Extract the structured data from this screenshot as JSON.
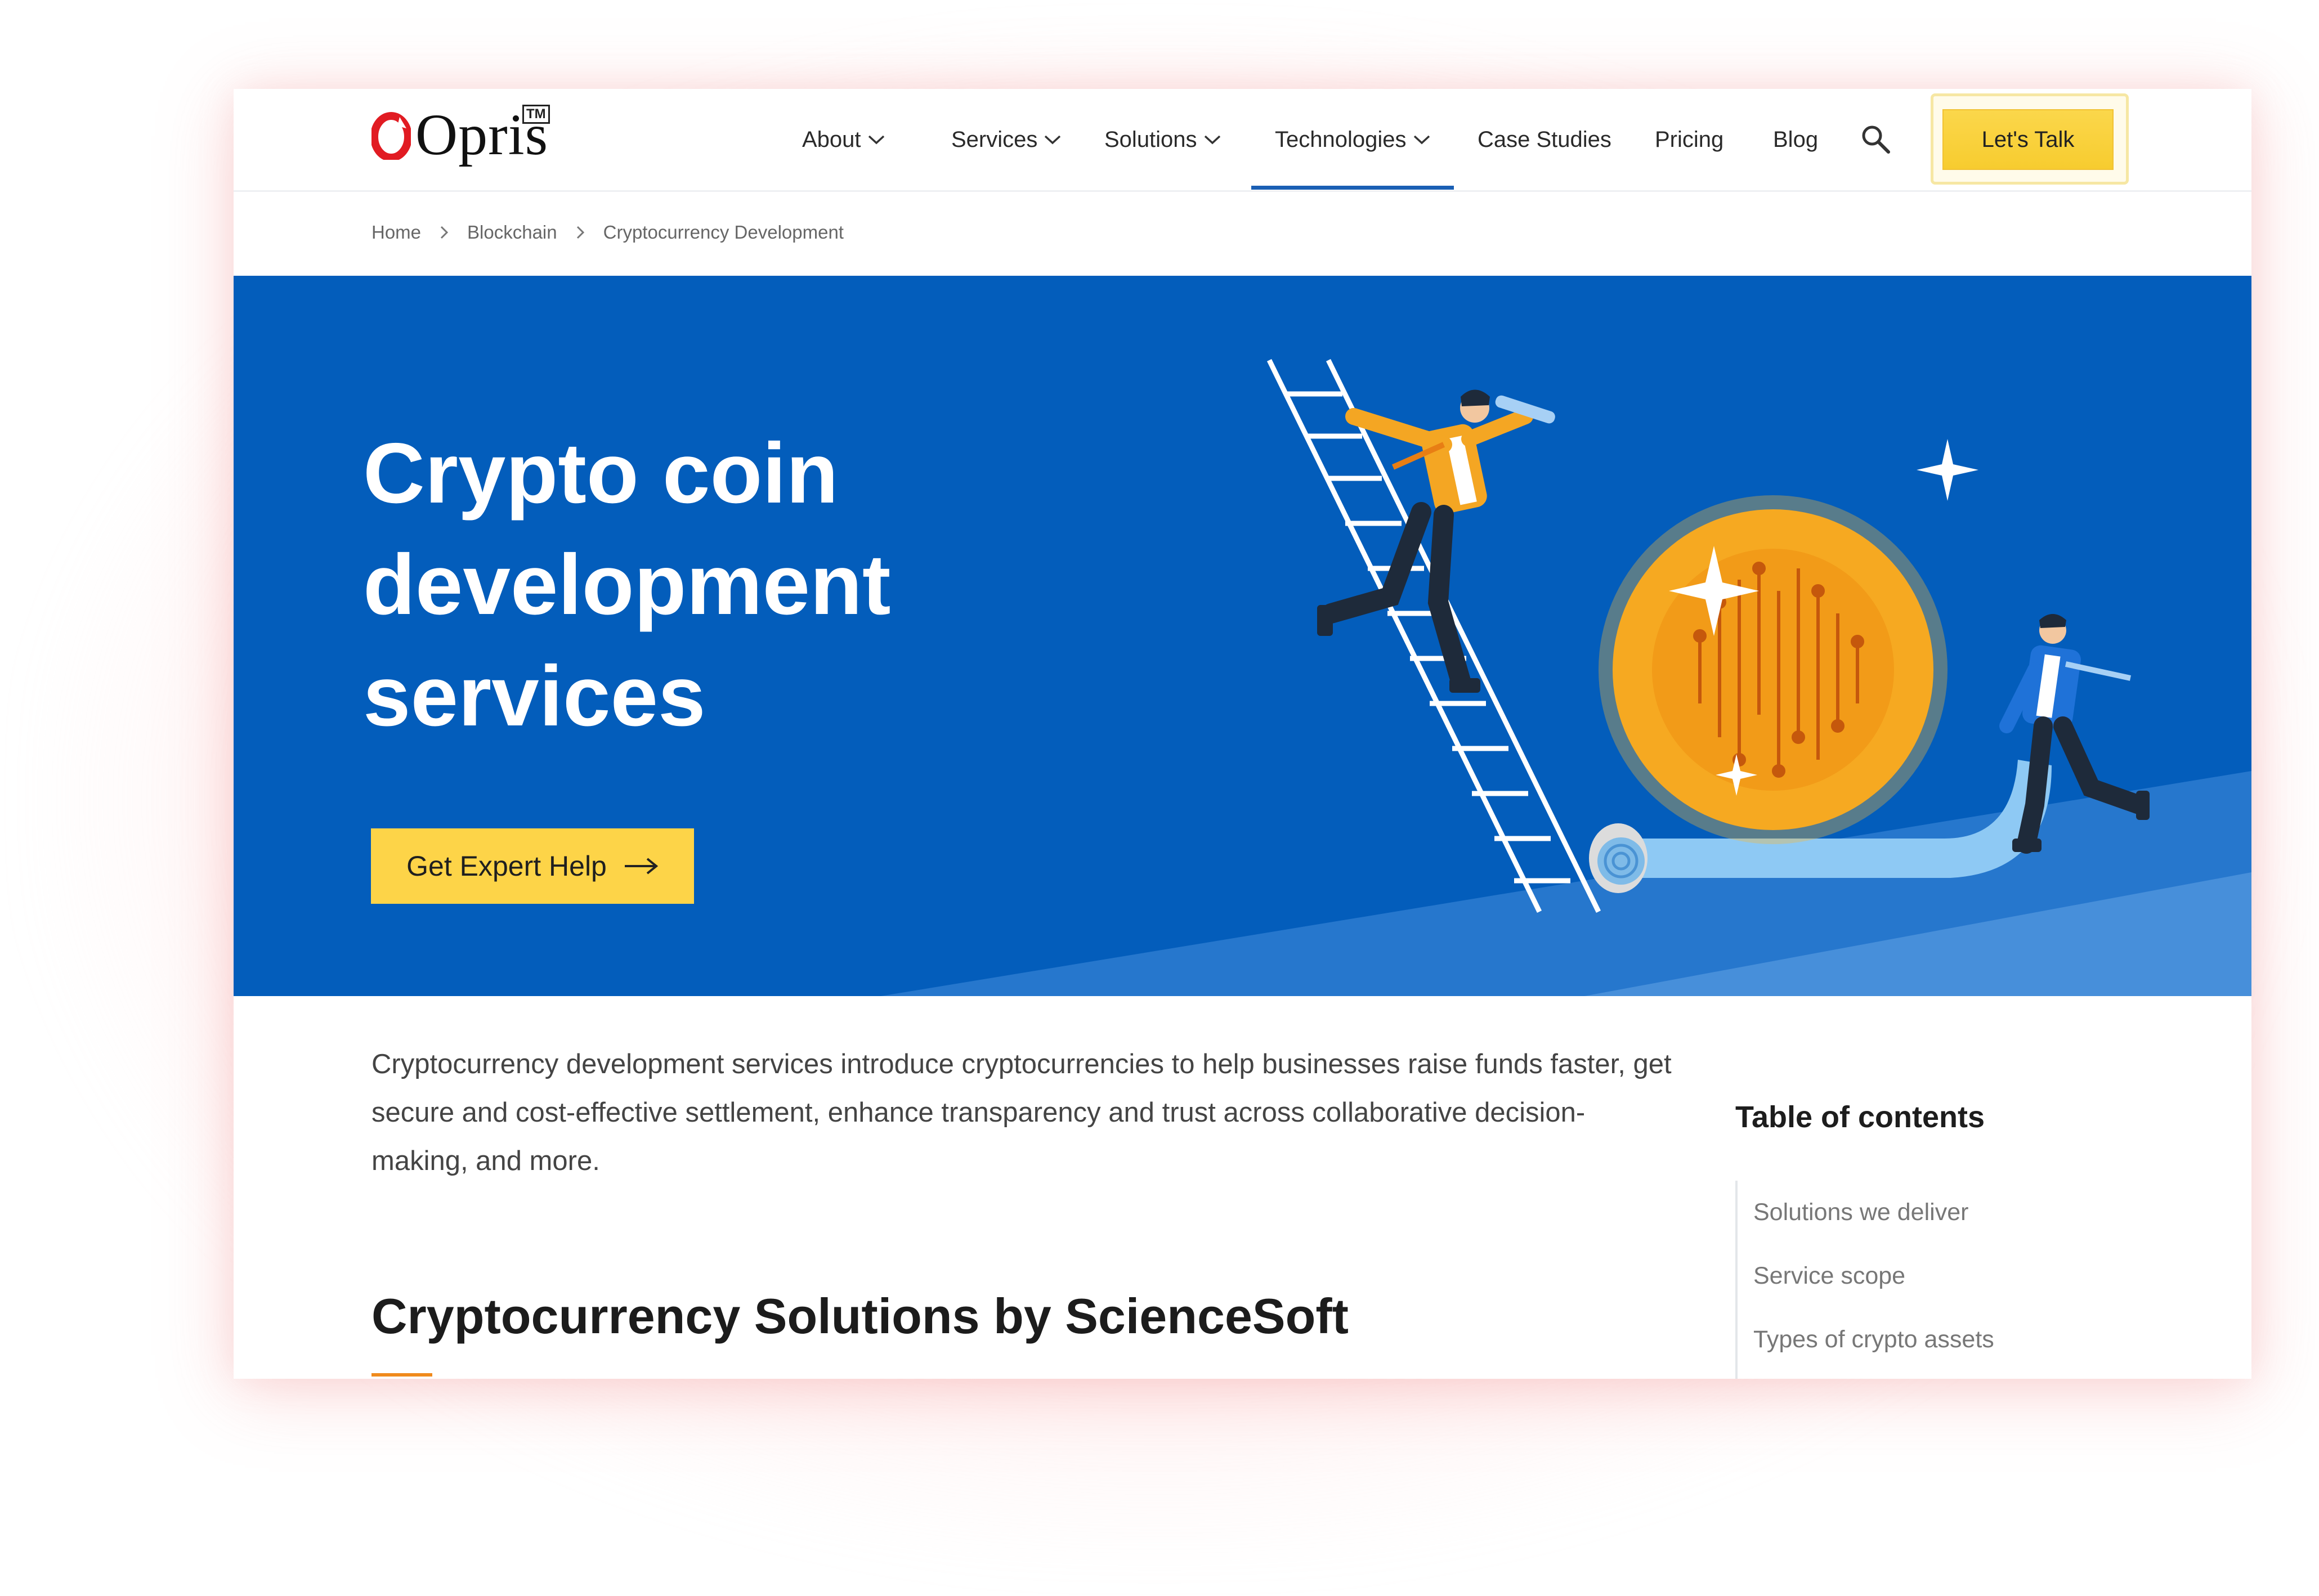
{
  "brand": {
    "name": "Opris",
    "trademark": "TM",
    "logo_o_color": "#e11b22"
  },
  "nav": {
    "items": [
      {
        "label": "About",
        "dropdown": true
      },
      {
        "label": "Services",
        "dropdown": true
      },
      {
        "label": "Solutions",
        "dropdown": true
      },
      {
        "label": "Technologies",
        "dropdown": true,
        "active": true
      },
      {
        "label": "Case Studies",
        "dropdown": false
      },
      {
        "label": "Pricing",
        "dropdown": false
      },
      {
        "label": "Blog",
        "dropdown": false
      }
    ],
    "search_icon": "search-icon",
    "cta_label": "Let's Talk"
  },
  "breadcrumb": [
    "Home",
    "Blockchain",
    "Cryptocurrency Development"
  ],
  "hero": {
    "title_lines": [
      "Crypto coin",
      "development",
      "services"
    ],
    "button_label": "Get Expert Help",
    "button_icon": "arrow-right-icon",
    "bg_color": "#035dbb",
    "button_color": "#fdd448"
  },
  "intro": "Cryptocurrency development services introduce cryptocurrencies to help businesses raise funds faster, get secure and cost-effective settlement, enhance transparency and trust across collaborative decision-making, and more.",
  "section_heading": "Cryptocurrency Solutions by ScienceSoft",
  "toc": {
    "title": "Table of contents",
    "items": [
      "Solutions we deliver",
      "Service scope",
      "Types of crypto assets"
    ]
  }
}
